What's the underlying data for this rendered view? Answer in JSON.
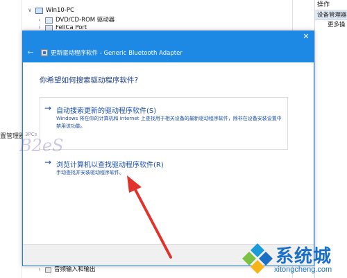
{
  "background": {
    "left_label": "置管理器",
    "tree": {
      "computer": "Win10-PC",
      "items": [
        "DVD/CD-ROM 驱动器",
        "FelICa Port"
      ],
      "bottom_item": "音频输入和输出"
    },
    "actions_panel": {
      "title": "操作",
      "section": "设备管理器",
      "more": "更多操"
    }
  },
  "dialog": {
    "close_glyph": "✕",
    "back_glyph": "←",
    "header_title": "更新驱动程序软件 - Generic Bluetooth Adapter",
    "question": "你希望如何搜索驱动程序软件?",
    "options": [
      {
        "arrow": "→",
        "title": "自动搜索更新的驱动程序软件(S)",
        "description": "Windows 将在你的计算机和 Internet 上查找用于相关设备的最新驱动程序软件，除非在设备安装设置中禁用该功能。"
      },
      {
        "arrow": "→",
        "title": "浏览计算机以查找驱动程序软件(R)",
        "description": "手动查找并安装驱动程序软件。"
      }
    ]
  },
  "watermarks": {
    "left_small": "3PCs",
    "left_logo": "B2eS",
    "brand_name": "系统城",
    "brand_url": "xitongcheng.com"
  },
  "colors": {
    "accent": "#1e88e5",
    "link_text": "#1a4ea8",
    "annotation_arrow": "#e0332b",
    "brand": "#1a6fc4"
  }
}
